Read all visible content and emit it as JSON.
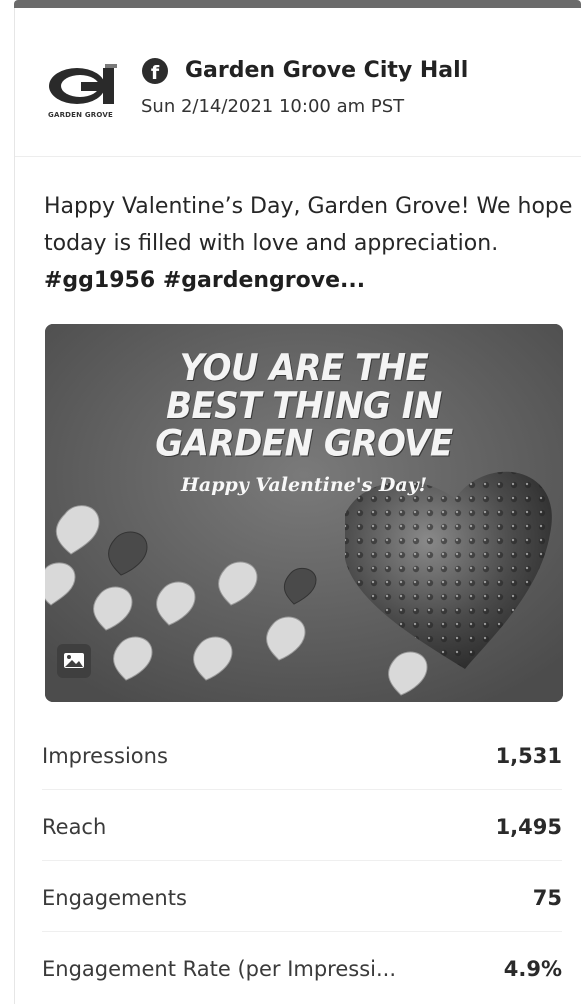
{
  "post": {
    "logo_text": "GARDEN GROVE",
    "platform_icon": "facebook-icon",
    "page_name": "Garden Grove City Hall",
    "timestamp": "Sun 2/14/2021 10:00 am PST",
    "text_plain": "Happy Valentine’s Day, Garden Grove! We hope today is filled with love and appreciation. ",
    "text_tags": "#gg1956 #gardengrove...",
    "image": {
      "headline_line1": "YOU ARE THE",
      "headline_line2": "BEST THING IN",
      "headline_line3": "GARDEN GROVE",
      "subline": "Happy Valentine's Day!",
      "badge_icon": "image-icon"
    }
  },
  "metrics": [
    {
      "label": "Impressions",
      "value": "1,531"
    },
    {
      "label": "Reach",
      "value": "1,495"
    },
    {
      "label": "Engagements",
      "value": "75"
    },
    {
      "label": "Engagement Rate (per Impressi...",
      "value": "4.9%"
    }
  ],
  "colors": {
    "background": "#ffffff",
    "topbar": "#6b6b6b",
    "image_bg": "#5f5f5f"
  }
}
